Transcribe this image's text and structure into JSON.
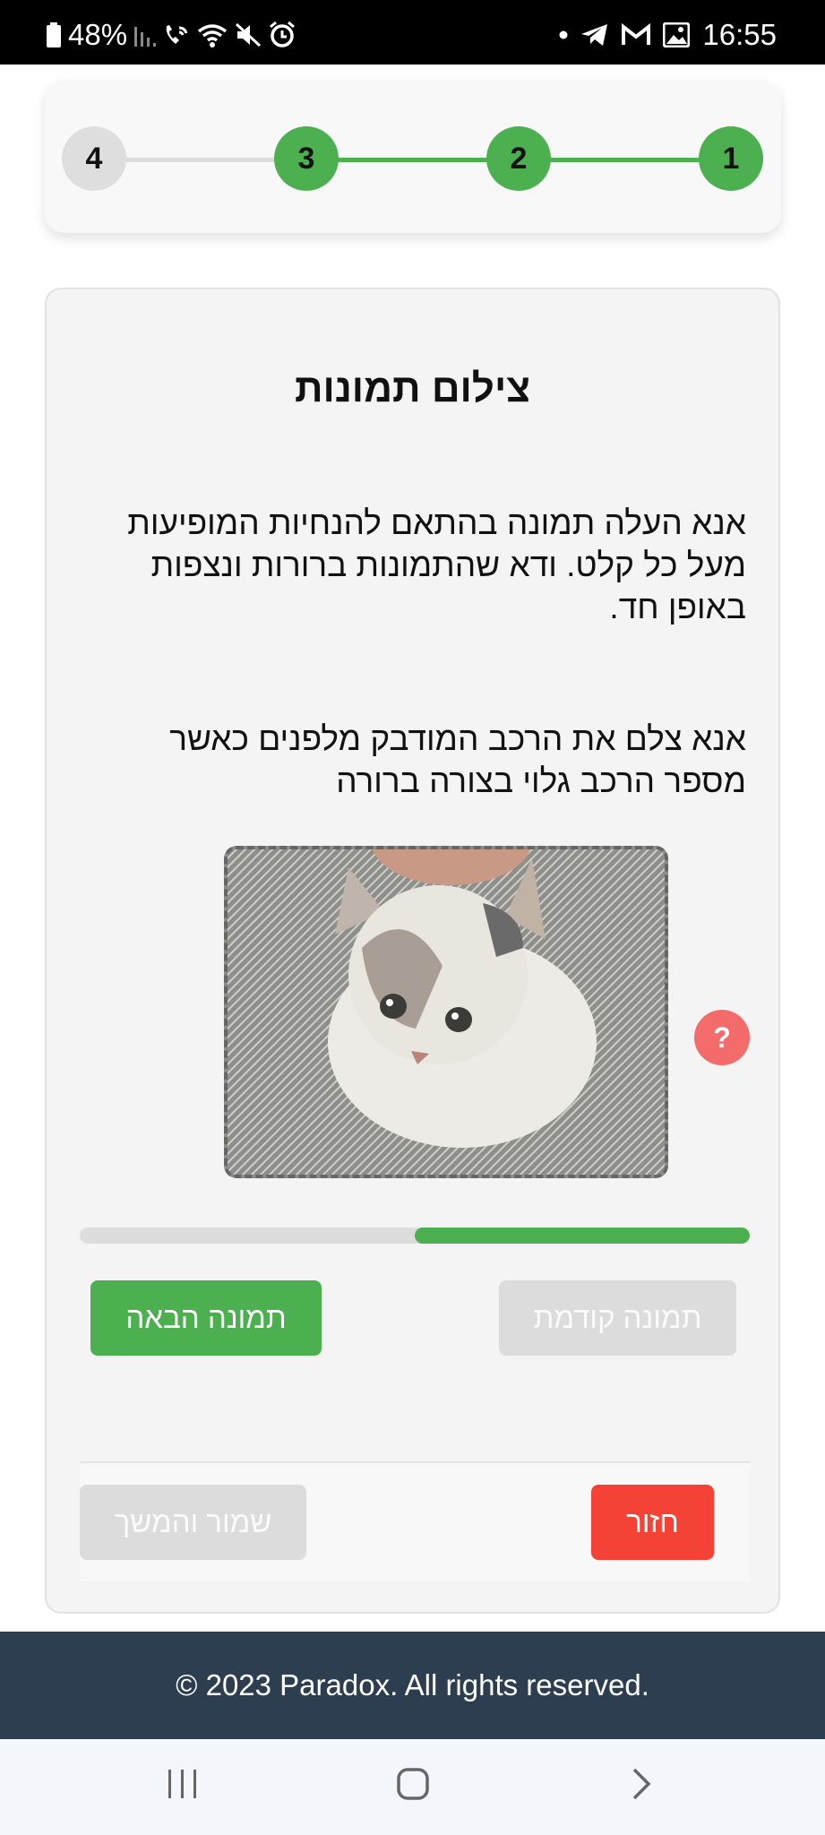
{
  "status_bar": {
    "battery": "48%",
    "time": "16:55",
    "colors": {
      "background": "#000000",
      "text": "#ffffff"
    },
    "icons_left": [
      "battery-icon",
      "signal-icon",
      "wifi-call-icon",
      "wifi-icon",
      "mute-icon",
      "alarm-icon"
    ],
    "icons_right": [
      "dot-icon",
      "telegram-icon",
      "gmail-icon",
      "gallery-icon"
    ]
  },
  "stepper": {
    "steps": [
      {
        "label": "1",
        "state": "done"
      },
      {
        "label": "2",
        "state": "done"
      },
      {
        "label": "3",
        "state": "done"
      },
      {
        "label": "4",
        "state": "todo"
      }
    ],
    "colors": {
      "done": "#4caf50",
      "todo": "#dedede"
    }
  },
  "card": {
    "title": "צילום תמונות",
    "instructions": "אנא העלה תמונה בהתאם להנחיות המופיעות מעל כל קלט. ודא שהתמונות ברורות ונצפות באופן חד.",
    "photo_instruction": "אנא צלם את הרכב המודבק מלפנים כאשר מספר הרכב גלוי בצורה ברורה",
    "photo_icon": "kitten-photo",
    "help_label": "?",
    "progress_fraction": 0.5,
    "next_photo_label": "תמונה הבאה",
    "prev_photo_label": "תמונה קודמת",
    "save_continue_label": "שמור והמשך",
    "back_label": "חזור"
  },
  "footer": {
    "copyright": "© 2023 Paradox. All rights reserved.",
    "background": "#2d3e50"
  },
  "nav_bar": {
    "icons": [
      "recents-icon",
      "home-icon",
      "back-icon"
    ]
  },
  "accent": {
    "green": "#4caf50",
    "red": "#f44336",
    "help": "#f36b6b"
  }
}
